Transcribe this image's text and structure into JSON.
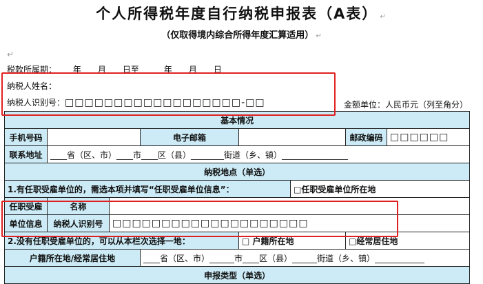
{
  "title": "个人所得税年度自行纳税申报表（A表）",
  "subtitle": "（仅取得境内综合所得年度汇算适用）",
  "period_label": "税款所属期：",
  "period_text": "年　　月　　日至　　　年　　月　　日",
  "name_label": "纳税人姓名：",
  "taxid_label": "纳税人识别号：",
  "taxid_boxes": "□□□□□□□□□□□□□□□□□□-□□",
  "amount_unit": "金额单位：人民币元（列至角分）",
  "sections": {
    "basic_info": "基本情况",
    "tax_location": "纳税地点（单选）",
    "declaration_type": "申报类型（单选）"
  },
  "basic": {
    "phone_label": "手机号码",
    "email_label": "电子邮箱",
    "postcode_label": "邮政编码",
    "postcode_boxes": "□□□□□□",
    "address_label": "联系地址",
    "address_template": "____省（区、市）____市____区（县）________街道（乡、镇）________________"
  },
  "location": {
    "option1_text": "1.有任职受雇单位的，需选本项并填写“任职受雇单位信息”：",
    "option1_check": "□任职受雇单位所在地",
    "employer_label_1": "任职受雇",
    "employer_label_2": "单位信息",
    "name_field_label": "名称",
    "taxid_field_label": "纳税人识别号",
    "employer_taxid_boxes": "□□□□□□□□□□□□□□□□□□□□",
    "option2_text": "2.没有任职受雇单位的，可以从本栏次选择一地：",
    "option2_check_a": "□ 户籍所在地",
    "option2_check_b": "□经常居住地",
    "residence_label": "户籍所在地/经常居住地",
    "residence_template": "____省（区、市）______市____区（县）______街道（乡、镇）____________"
  }
}
